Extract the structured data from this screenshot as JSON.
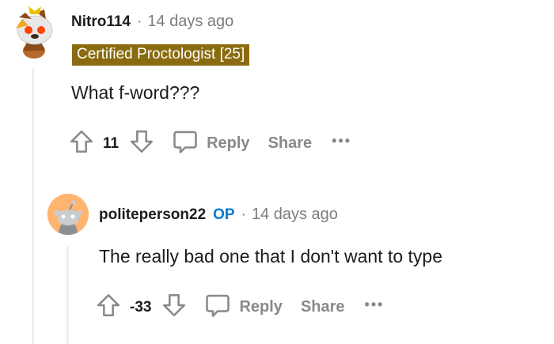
{
  "comments": [
    {
      "username": "Nitro114",
      "separator": "·",
      "timestamp": "14 days ago",
      "flair": "Certified Proctologist [25]",
      "body": "What f-word???",
      "score": "11",
      "reply_label": "Reply",
      "share_label": "Share",
      "more_label": "•••"
    },
    {
      "username": "politeperson22",
      "op_badge": "OP",
      "separator": "·",
      "timestamp": "14 days ago",
      "body": "The really bad one that I don't want to type",
      "score": "-33",
      "reply_label": "Reply",
      "share_label": "Share",
      "more_label": "•••"
    }
  ],
  "icons": {
    "upvote": "arrow-up-outline",
    "downvote": "arrow-down-outline",
    "reply": "speech-bubble-outline",
    "more": "ellipsis"
  },
  "colors": {
    "flair_bg": "#8a6b10",
    "op_badge": "#0079d3",
    "muted": "#878a8c",
    "thread_line": "#edeff1",
    "avatar_bg": "#ffb470"
  }
}
